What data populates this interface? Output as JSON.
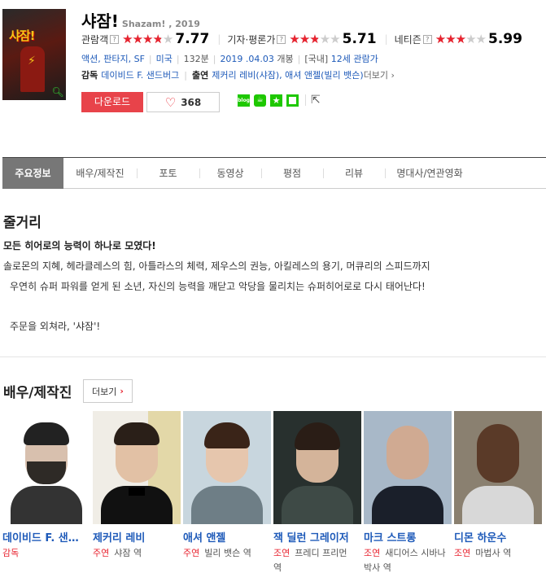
{
  "movie": {
    "title": "샤잠!",
    "subtitle": "Shazam! , 2019",
    "poster_title": "샤잠!",
    "ratings": [
      {
        "label": "관람객",
        "score": "7.77",
        "fraction": 0.777
      },
      {
        "label": "기자·평론가",
        "score": "5.71",
        "fraction": 0.571
      },
      {
        "label": "네티즌",
        "score": "5.99",
        "fraction": 0.599
      }
    ],
    "help_mark": "?",
    "genre": "액션, 판타지, SF",
    "country": "미국",
    "runtime": "132분",
    "release": "2019 .04.03",
    "release_suffix": "개봉",
    "rating_prefix": "[국내]",
    "age_rating": "12세 관람가",
    "director_label": "감독",
    "director": "데이비드 F. 샌드버그",
    "cast_label": "출연",
    "cast_list": "제커리 레비(샤잠), 애셔 앤젤(빌리 뱃슨)",
    "cast_more": "더보기 ›",
    "download_label": "다운로드",
    "like_count": "368",
    "share_icons": [
      "blog-icon",
      "cafe-icon",
      "star-icon",
      "square-icon"
    ]
  },
  "tabs": [
    {
      "label": "주요정보",
      "active": true
    },
    {
      "label": "배우/제작진"
    },
    {
      "label": "포토"
    },
    {
      "label": "동영상"
    },
    {
      "label": "평점"
    },
    {
      "label": "리뷰"
    },
    {
      "label": "명대사/연관영화"
    }
  ],
  "synopsis": {
    "title": "줄거리",
    "headline": "모든 히어로의 능력이 하나로 모였다!",
    "lines": [
      "솔로몬의 지혜, 헤라클레스의 힘, 아틀라스의 체력, 제우스의 권능, 아킬레스의 용기, 머큐리의 스피드까지",
      "우연히 슈퍼 파워를 얻게 된 소년, 자신의 능력을 깨닫고 악당을 물리치는 슈퍼히어로로 다시 태어난다!",
      "주문을 외쳐라, '샤잠'!"
    ]
  },
  "cast_section": {
    "title": "배우/제작진",
    "more_label": "더보기",
    "members": [
      {
        "name": "데이비드 F. 샌드버그",
        "role_type": "감독",
        "character": ""
      },
      {
        "name": "제커리 레비",
        "role_type": "주연",
        "character": "샤잠 역"
      },
      {
        "name": "애셔 앤젤",
        "role_type": "주연",
        "character": "빌리 뱃슨 역"
      },
      {
        "name": "잭 딜런 그레이저",
        "role_type": "조연",
        "character": "프레디 프리먼 역"
      },
      {
        "name": "마크 스트롱",
        "role_type": "조연",
        "character": "새디어스 시바나 박사 역"
      },
      {
        "name": "디몬 하운수",
        "role_type": "조연",
        "character": "마법사 역"
      }
    ]
  },
  "colors": {
    "accent": "#e8232f",
    "link": "#1e5ab9",
    "download": "#e8434a",
    "tab_active": "#777777"
  }
}
